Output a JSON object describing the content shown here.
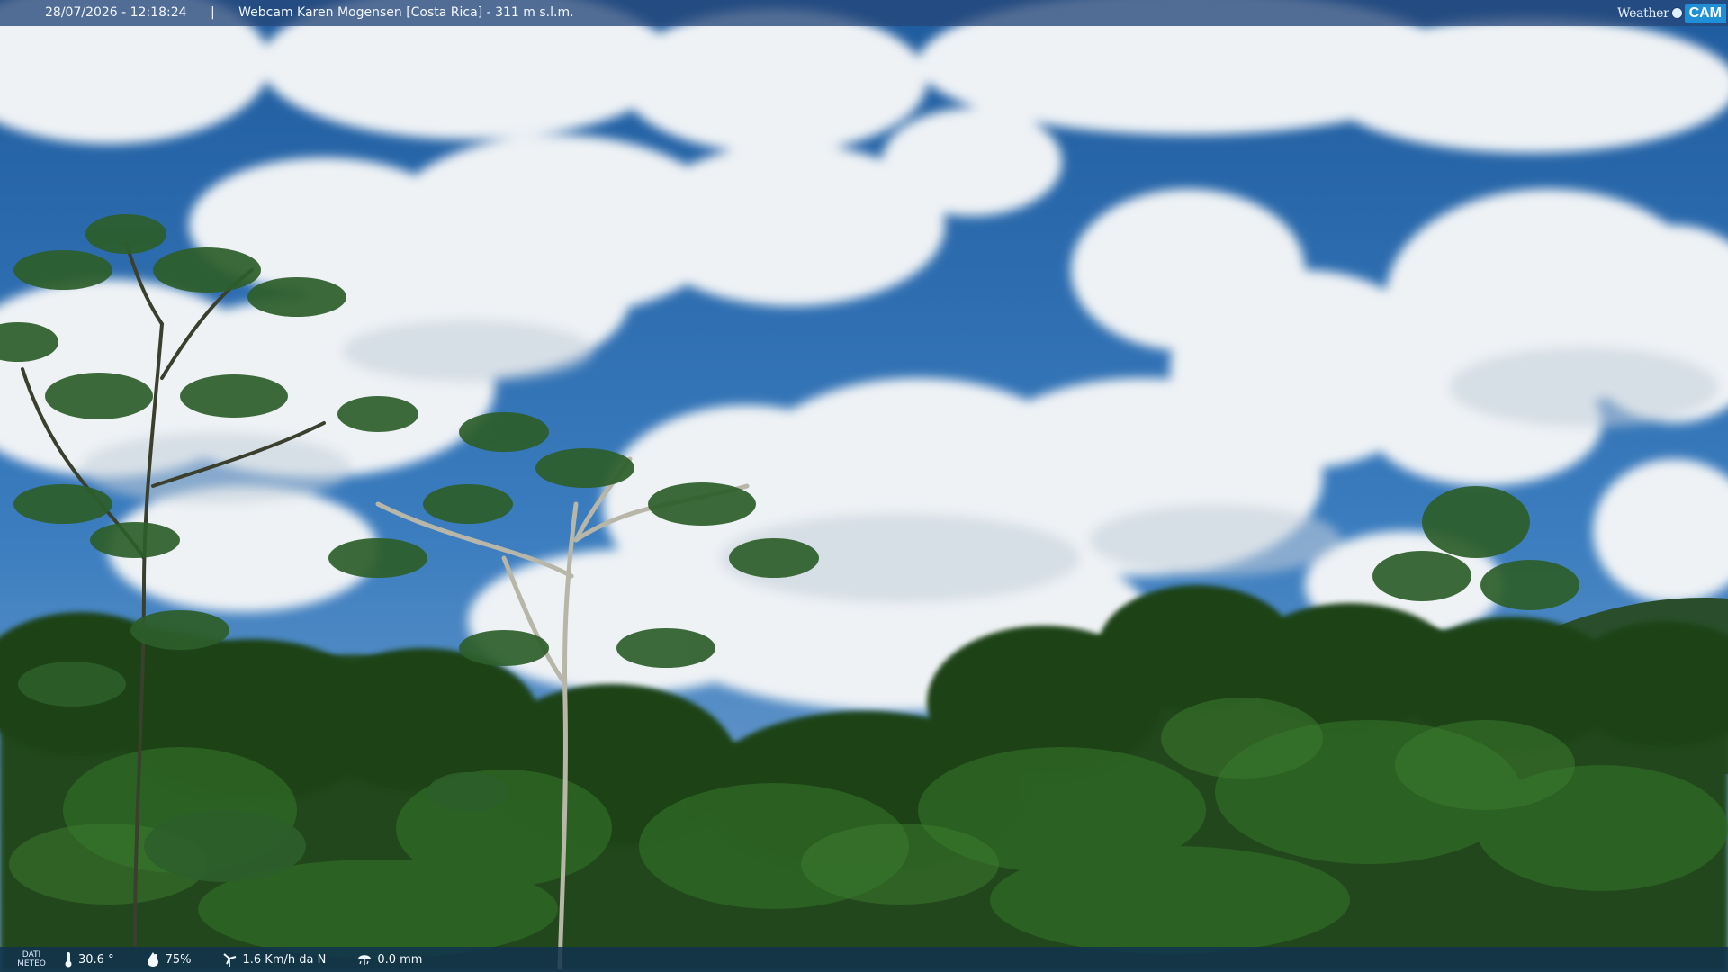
{
  "header": {
    "datetime": "28/07/2026 - 12:18:24",
    "separator": "|",
    "location": "Webcam Karen Mogensen [Costa Rica] - 311 m s.l.m."
  },
  "brand": {
    "weather": "Weather",
    "cam": "CAM"
  },
  "footer": {
    "label_line1": "DATI",
    "label_line2": "METEO",
    "temperature": "30.6 °",
    "humidity": "75%",
    "wind": "1.6 Km/h da N",
    "rain": "0.0 mm"
  },
  "colors": {
    "sky": "#2f6fb3",
    "cloud": "#f4f6f8",
    "forest": "#1f4d1b",
    "header_bar": "#26487a",
    "footer_bar": "#10324e",
    "brand_accent": "#1f8fd8"
  },
  "icons": {
    "temperature": "thermometer-icon",
    "humidity": "humidity-drop-icon",
    "wind": "wind-turbine-icon",
    "rain": "rain-icon"
  }
}
